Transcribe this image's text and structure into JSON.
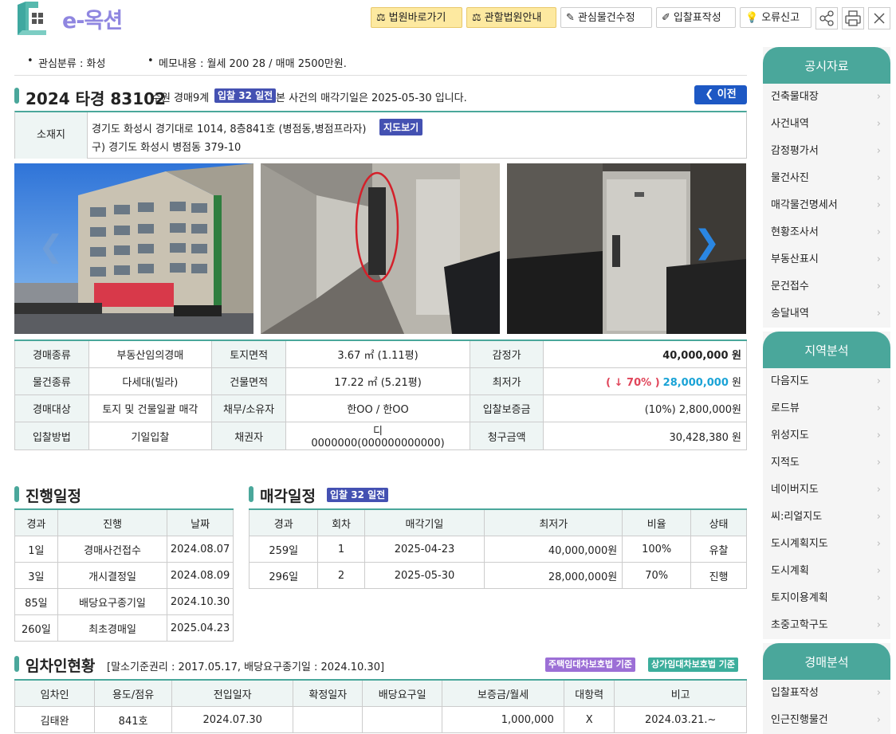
{
  "header": {
    "logo_text": "e-옥션",
    "buttons": [
      {
        "label": "법원바로가기",
        "icon": "judge-icon"
      },
      {
        "label": "관할법원안내",
        "icon": "judge-icon"
      },
      {
        "label": "관심물건수정",
        "icon": "edit-icon"
      },
      {
        "label": "입찰표작성",
        "icon": "pencil-icon"
      },
      {
        "label": "오류신고",
        "icon": "bulb-icon"
      }
    ]
  },
  "memo": {
    "category": "관심분류 : 화성",
    "note": "메모내용 : 월세 200 28 / 매매 2500만원."
  },
  "case": {
    "number": "2024 타경 83102",
    "court": "수원 경매9계",
    "badge": "입찰 32 일전",
    "notice": "본 사건의 매각기일은 2025-05-30 입니다.",
    "prev_label": "이전"
  },
  "location": {
    "label": "소재지",
    "address": "경기도 화성시 경기대로 1014, 8층841호 (병점동,병점프라자)",
    "old_address": "구) 경기도 화성시 병점동 379-10",
    "map_button": "지도보기"
  },
  "info": [
    [
      {
        "h": "경매종류"
      },
      {
        "v": "부동산임의경매"
      },
      {
        "h": "토지면적"
      },
      {
        "v": "3.67 ㎡ (1.11평)"
      },
      {
        "h": "감정가"
      },
      {
        "v": "40,000,000 원",
        "bold": true,
        "right": true
      }
    ],
    [
      {
        "h": "물건종류"
      },
      {
        "v": "다세대(빌라)"
      },
      {
        "h": "건물면적"
      },
      {
        "v": "17.22 ㎡ (5.21평)"
      },
      {
        "h": "최저가"
      },
      {
        "v": "",
        "special": "min"
      }
    ],
    [
      {
        "h": "경매대상"
      },
      {
        "v": "토지 및 건물일괄 매각"
      },
      {
        "h": "채무/소유자"
      },
      {
        "v": "한OO / 한OO"
      },
      {
        "h": "입찰보증금"
      },
      {
        "v": "(10%) 2,800,000원",
        "right": true
      }
    ],
    [
      {
        "h": "입찰방법"
      },
      {
        "v": "기일입찰"
      },
      {
        "h": "채권자"
      },
      {
        "v": "디\n0000000(000000000000)"
      },
      {
        "h": "청구금액"
      },
      {
        "v": "30,428,380 원",
        "right": true
      }
    ]
  ],
  "min_price": {
    "pct": "( ↓ 70% )",
    "value": "28,000,000",
    "unit": " 원"
  },
  "progress": {
    "title": "진행일정",
    "headers": [
      "경과",
      "진행",
      "날짜"
    ],
    "rows": [
      [
        "1일",
        "경매사건접수",
        "2024.08.07"
      ],
      [
        "3일",
        "개시결정일",
        "2024.08.09"
      ],
      [
        "85일",
        "배당요구종기일",
        "2024.10.30"
      ],
      [
        "260일",
        "최초경매일",
        "2025.04.23"
      ]
    ]
  },
  "sale": {
    "title": "매각일정",
    "badge": "입찰 32 일전",
    "headers": [
      "경과",
      "회차",
      "매각기일",
      "최저가",
      "비율",
      "상태"
    ],
    "rows": [
      [
        "259일",
        "1",
        "2025-04-23",
        "40,000,000원",
        "100%",
        "유찰"
      ],
      [
        "296일",
        "2",
        "2025-05-30",
        "28,000,000원",
        "70%",
        "진행"
      ]
    ]
  },
  "tenant": {
    "title": "임차인현황",
    "sub": "[말소기준권리 : 2017.05.17, 배당요구종기일 : 2024.10.30]",
    "tag1": "주택임대차보호법 기준",
    "tag2": "상가임대차보호법 기준",
    "headers": [
      "임차인",
      "용도/점유",
      "전입일자",
      "확정일자",
      "배당요구일",
      "보증금/월세",
      "대항력",
      "비고"
    ],
    "row": [
      "김태완",
      "841호",
      "2024.07.30",
      "",
      "",
      "1,000,000",
      "X",
      "2024.03.21.~"
    ]
  },
  "sidebar": [
    {
      "title": "공시자료",
      "items": [
        "건축물대장",
        "사건내역",
        "감정평가서",
        "물건사진",
        "매각물건명세서",
        "현황조사서",
        "부동산표시",
        "문건접수",
        "송달내역"
      ]
    },
    {
      "title": "지역분석",
      "items": [
        "다음지도",
        "로드뷰",
        "위성지도",
        "지적도",
        "네이버지도",
        "씨:리얼지도",
        "도시계획지도",
        "도시계획",
        "토지이용계획",
        "초중고학구도"
      ]
    },
    {
      "title": "경매분석",
      "items": [
        "입찰표작성",
        "인근진행물건"
      ]
    }
  ],
  "colors": {
    "accent": "#4aa79b",
    "badge": "#4451b2",
    "prev": "#1d58c4",
    "min_pct": "#e0455a",
    "min_value": "#1aa3d6"
  }
}
